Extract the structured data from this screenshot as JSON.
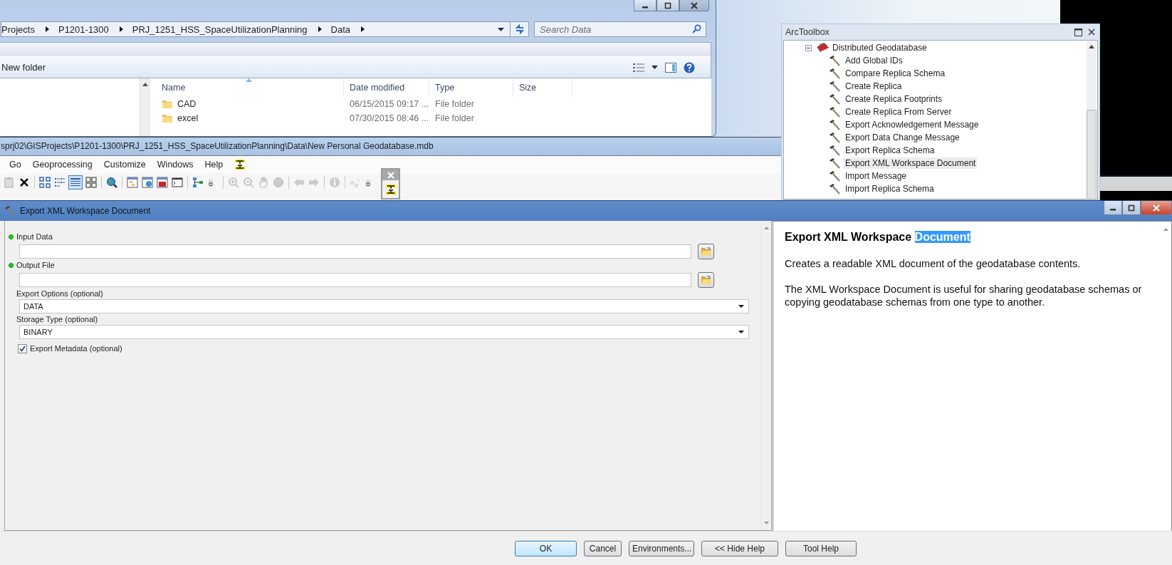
{
  "explorer": {
    "breadcrumb": [
      "Projects",
      "P1201-1300",
      "PRJ_1251_HSS_SpaceUtilizationPlanning",
      "Data"
    ],
    "search": {
      "placeholder": "Search Data"
    },
    "command": "New folder",
    "columns": [
      {
        "label": "Name",
        "sorted": true
      },
      {
        "label": "Date modified",
        "sorted": false
      },
      {
        "label": "Type",
        "sorted": false
      },
      {
        "label": "Size",
        "sorted": false
      }
    ],
    "rows": [
      {
        "name": "CAD",
        "date_modified": "06/15/2015 09:17 ...",
        "type": "File folder"
      },
      {
        "name": "excel",
        "date_modified": "07/30/2015 08:46 ...",
        "type": "File folder"
      }
    ]
  },
  "catalog": {
    "title": "sprj02\\GISProjects\\P1201-1300\\PRJ_1251_HSS_SpaceUtilizationPlanning\\Data\\New Personal Geodatabase.mdb",
    "menu": [
      "Go",
      "Geoprocessing",
      "Customize",
      "Windows",
      "Help"
    ]
  },
  "toolbox": {
    "title": "ArcToolbox",
    "tree": [
      {
        "label": "Distributed Geodatabase",
        "expanded": true,
        "children": [
          {
            "label": "Add Global IDs",
            "selected": false
          },
          {
            "label": "Compare Replica Schema",
            "selected": false
          },
          {
            "label": "Create Replica",
            "selected": false
          },
          {
            "label": "Create Replica Footprints",
            "selected": false
          },
          {
            "label": "Create Replica From Server",
            "selected": false
          },
          {
            "label": "Export Acknowledgement Message",
            "selected": false
          },
          {
            "label": "Export Data Change Message",
            "selected": false
          },
          {
            "label": "Export Replica Schema",
            "selected": false
          },
          {
            "label": "Export XML Workspace Document",
            "selected": true
          },
          {
            "label": "Import Message",
            "selected": false
          },
          {
            "label": "Import Replica Schema",
            "selected": false
          }
        ]
      }
    ]
  },
  "dialog": {
    "title": "Export XML Workspace Document",
    "parameters": [
      {
        "kind": "path",
        "label": "Input Data",
        "required": true
      },
      {
        "kind": "path",
        "label": "Output File",
        "required": true
      },
      {
        "kind": "dropdown",
        "label": "Export Options (optional)",
        "required": false,
        "value": "DATA"
      },
      {
        "kind": "dropdown",
        "label": "Storage Type (optional)",
        "required": false,
        "value": "BINARY"
      },
      {
        "kind": "checkbox",
        "label": "Export Metadata (optional)",
        "checked": true
      }
    ],
    "help": {
      "title": "Export XML Workspace",
      "title_selection": "Document",
      "paragraphs": [
        "Creates a readable XML document of the geodatabase contents.",
        "The XML Workspace Document is useful for sharing geodatabase schemas or copying geodatabase schemas from one type to another."
      ]
    },
    "buttons": [
      {
        "label": "OK",
        "default": true
      },
      {
        "label": "Cancel",
        "default": false
      },
      {
        "label": "Environments...",
        "default": false
      },
      {
        "label": "<< Hide Help",
        "default": false
      },
      {
        "label": "Tool Help",
        "default": false
      }
    ]
  }
}
